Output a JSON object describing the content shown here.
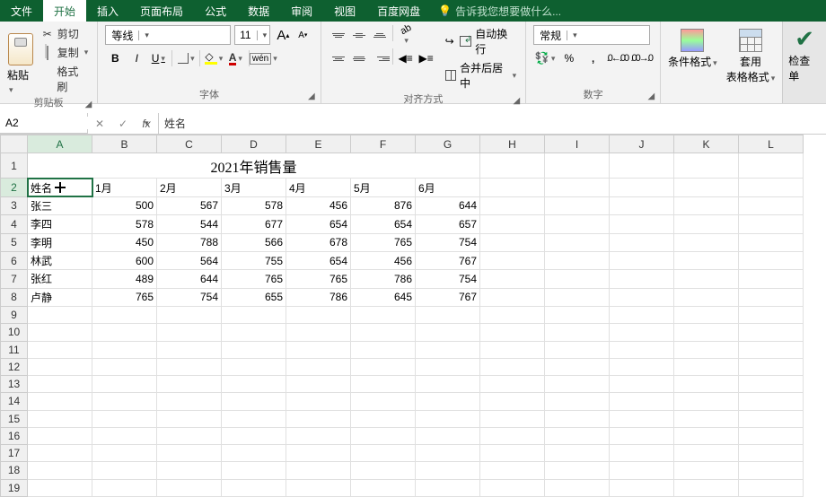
{
  "tabs": {
    "file": "文件",
    "home": "开始",
    "insert": "插入",
    "layout": "页面布局",
    "formula": "公式",
    "data": "数据",
    "review": "审阅",
    "view": "视图",
    "baidu": "百度网盘"
  },
  "hint": "告诉我您想要做什么...",
  "clipboard": {
    "paste": "粘贴",
    "cut": "剪切",
    "copy": "复制",
    "brush": "格式刷",
    "label": "剪贴板"
  },
  "font": {
    "name": "等线",
    "size": "11",
    "bold": "B",
    "italic": "I",
    "underline": "U",
    "wen": "wén",
    "label": "字体"
  },
  "align": {
    "wrap": "自动换行",
    "merge": "合并后居中",
    "label": "对齐方式"
  },
  "number": {
    "format": "常规",
    "label": "数字"
  },
  "styles": {
    "cond": "条件格式",
    "table": "套用\n表格格式",
    "check": "检查单"
  },
  "namebox": "A2",
  "fx_value": "姓名",
  "cols": [
    "A",
    "B",
    "C",
    "D",
    "E",
    "F",
    "G",
    "H",
    "I",
    "J",
    "K",
    "L"
  ],
  "rows_vis": 19,
  "title_text": "2021年销售量",
  "headers": [
    "姓名",
    "1月",
    "2月",
    "3月",
    "4月",
    "5月",
    "6月"
  ],
  "data_rows": [
    [
      "张三",
      500,
      567,
      578,
      456,
      876,
      644
    ],
    [
      "李四",
      578,
      544,
      677,
      654,
      654,
      657
    ],
    [
      "李明",
      450,
      788,
      566,
      678,
      765,
      754
    ],
    [
      "林武",
      600,
      564,
      755,
      654,
      456,
      767
    ],
    [
      "张红",
      489,
      644,
      765,
      765,
      786,
      754
    ],
    [
      "卢静",
      765,
      754,
      655,
      786,
      645,
      767
    ]
  ],
  "chart_data": {
    "type": "table",
    "title": "2021年销售量",
    "categories": [
      "1月",
      "2月",
      "3月",
      "4月",
      "5月",
      "6月"
    ],
    "series": [
      {
        "name": "张三",
        "values": [
          500,
          567,
          578,
          456,
          876,
          644
        ]
      },
      {
        "name": "李四",
        "values": [
          578,
          544,
          677,
          654,
          654,
          657
        ]
      },
      {
        "name": "李明",
        "values": [
          450,
          788,
          566,
          678,
          765,
          754
        ]
      },
      {
        "name": "林武",
        "values": [
          600,
          564,
          755,
          654,
          456,
          767
        ]
      },
      {
        "name": "张红",
        "values": [
          489,
          644,
          765,
          765,
          786,
          754
        ]
      },
      {
        "name": "卢静",
        "values": [
          765,
          754,
          655,
          786,
          645,
          767
        ]
      }
    ]
  }
}
